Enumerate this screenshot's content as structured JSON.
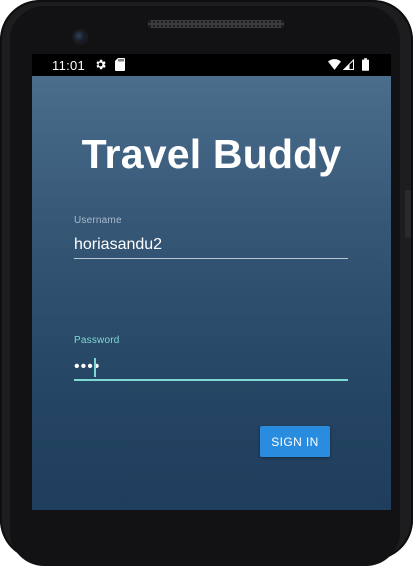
{
  "status_bar": {
    "time": "11:01",
    "icons": [
      "gear-icon",
      "sd-card-icon",
      "wifi-icon",
      "signal-icon",
      "battery-icon"
    ]
  },
  "app": {
    "title": "Travel Buddy"
  },
  "username": {
    "label": "Username",
    "value": "horiasandu2"
  },
  "password": {
    "label": "Password",
    "masked_value": "••••"
  },
  "sign_in": {
    "label": "SIGN IN"
  },
  "colors": {
    "accent": "#7ed9d2",
    "button": "#2a8cdf",
    "background_top": "#4b6e8d",
    "background_bottom": "#1f3d5c",
    "status_bar": "#000000"
  }
}
